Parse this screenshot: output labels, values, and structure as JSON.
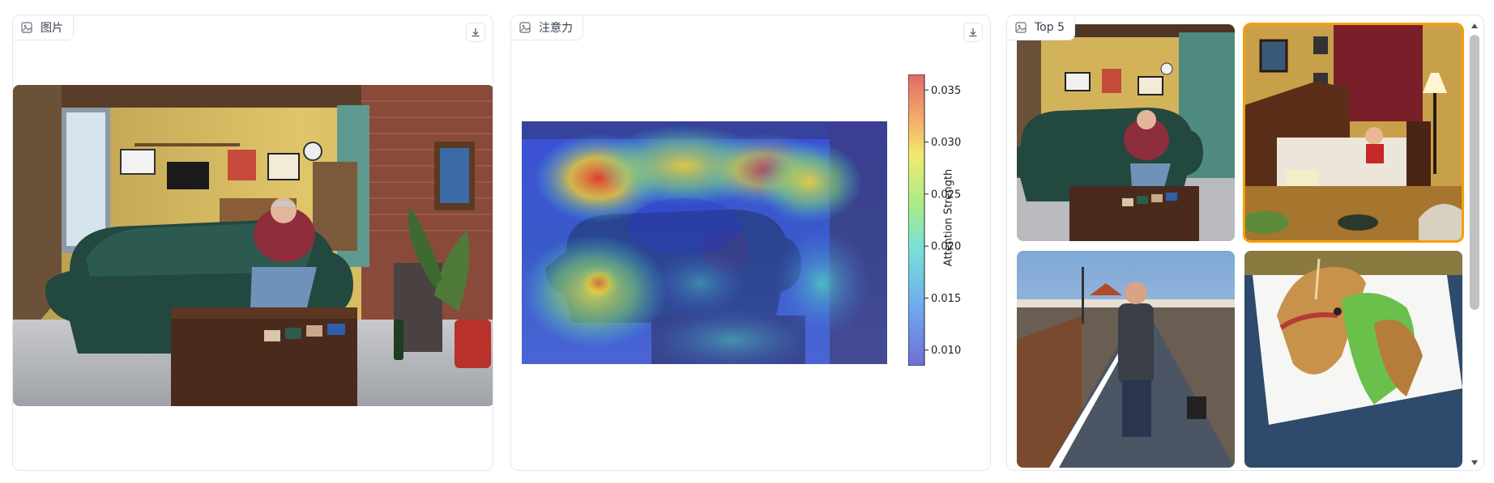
{
  "panels": {
    "image": {
      "label": "图片"
    },
    "attention": {
      "label": "注意力",
      "colorbar": {
        "label": "Attention Strength",
        "ticks": [
          "0.035",
          "0.030",
          "0.025",
          "0.020",
          "0.015",
          "0.010"
        ],
        "range": [
          0.0085,
          0.0365
        ]
      }
    },
    "top5": {
      "label": "Top 5",
      "selected_index": 1
    }
  },
  "icons": {
    "image_icon": "image-icon",
    "download_icon": "download-icon",
    "scroll_up": "chevron-up-icon",
    "scroll_down": "chevron-down-icon"
  },
  "colors": {
    "border": "#e5e7eb",
    "selected_outline": "#f59e0b",
    "scrollbar": "#c1c1c1"
  }
}
